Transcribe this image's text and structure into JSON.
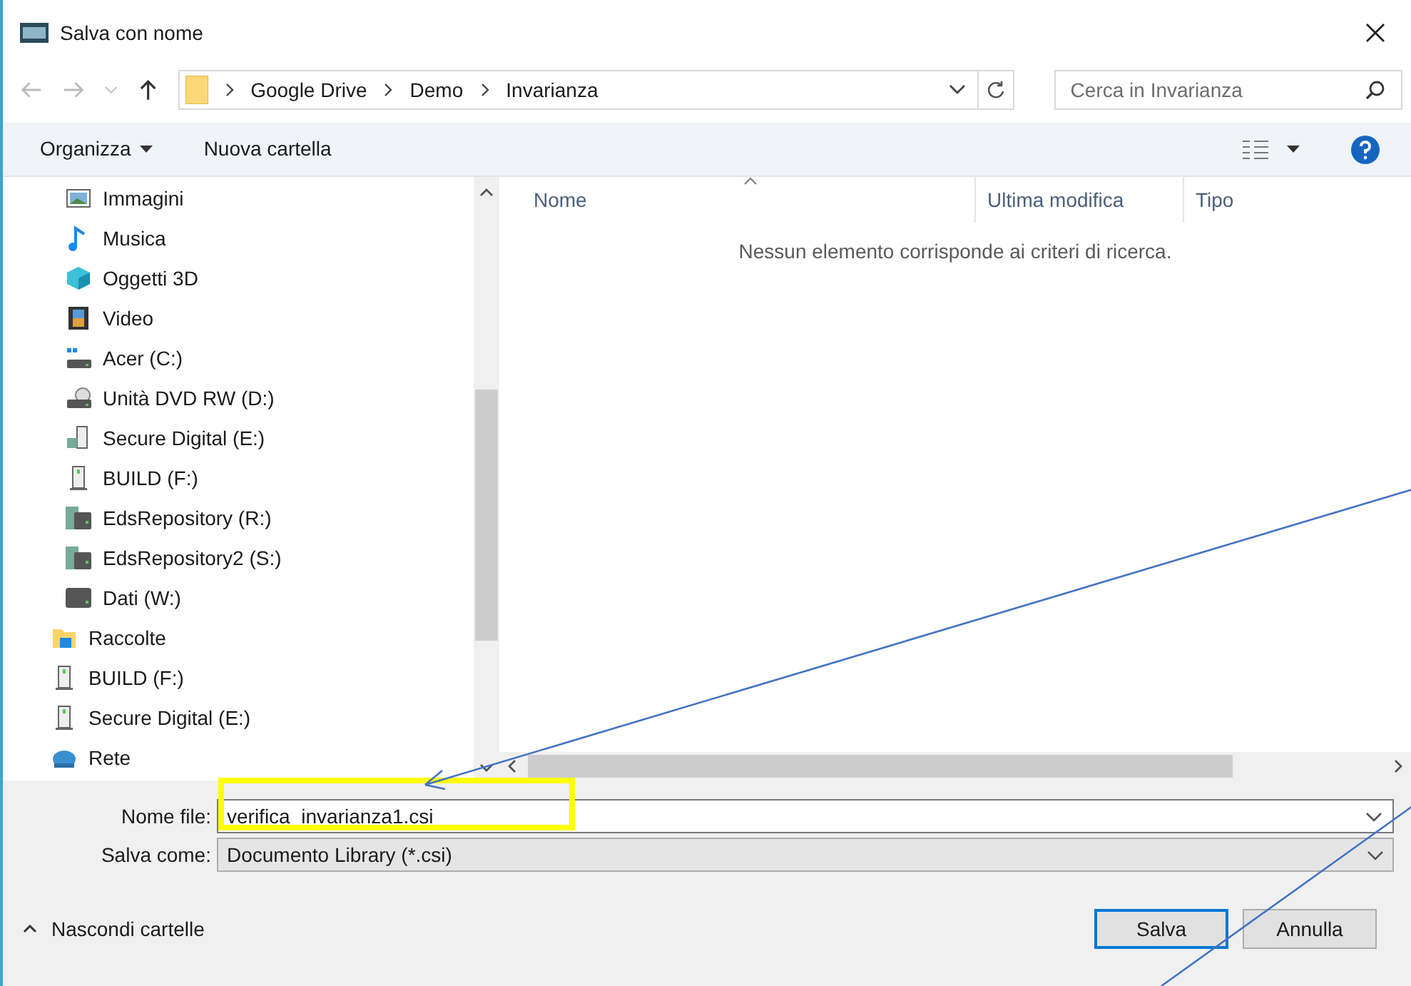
{
  "window": {
    "title": "Salva con nome"
  },
  "address": {
    "path": [
      "Google Drive",
      "Demo",
      "Invarianza"
    ]
  },
  "search": {
    "placeholder": "Cerca in Invarianza"
  },
  "toolbar": {
    "organize": "Organizza",
    "new_folder": "Nuova cartella"
  },
  "nav_pane": {
    "nested_items": [
      {
        "label": "Immagini",
        "kind": "pictures"
      },
      {
        "label": "Musica",
        "kind": "music"
      },
      {
        "label": "Oggetti 3D",
        "kind": "objects"
      },
      {
        "label": "Video",
        "kind": "video"
      },
      {
        "label": "Acer (C:)",
        "kind": "system"
      },
      {
        "label": "Unità DVD RW (D:)",
        "kind": "dvd"
      },
      {
        "label": "Secure Digital (E:)",
        "kind": "sd"
      },
      {
        "label": "BUILD (F:)",
        "kind": "usb"
      },
      {
        "label": "EdsRepository (R:)",
        "kind": "netdrive"
      },
      {
        "label": "EdsRepository2 (S:)",
        "kind": "netdrive"
      },
      {
        "label": "Dati (W:)",
        "kind": "drive"
      }
    ],
    "items": [
      {
        "label": "Raccolte",
        "kind": "library"
      },
      {
        "label": "BUILD (F:)",
        "kind": "usb"
      },
      {
        "label": "Secure Digital (E:)",
        "kind": "usb"
      },
      {
        "label": "Rete",
        "kind": "network"
      }
    ]
  },
  "file_list": {
    "columns": [
      "Nome",
      "Ultima modifica",
      "Tipo"
    ],
    "empty_message": "Nessun elemento corrisponde ai criteri di ricerca."
  },
  "form": {
    "filename_label": "Nome file:",
    "filename": "verifica_invarianza1.csi",
    "type_label": "Salva come:",
    "type": "Documento Library (*.csi)"
  },
  "footer": {
    "hide_folders": "Nascondi cartelle",
    "buttons": [
      {
        "label": "Salva",
        "selected": true
      },
      {
        "label": "Annulla",
        "selected": false
      }
    ]
  }
}
